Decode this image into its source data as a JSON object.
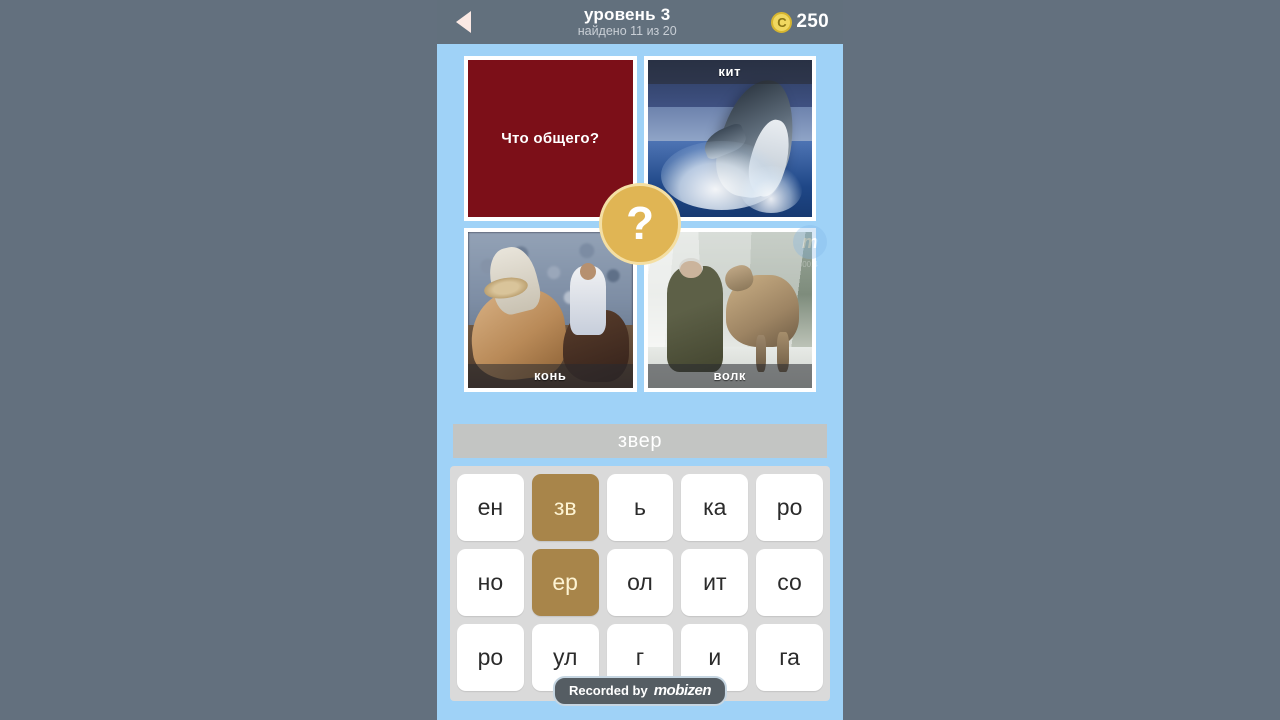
{
  "colors": {
    "letterbox": "#63707e",
    "header_bg": "#62707d",
    "app_bg": "#9fd2f7",
    "question_tile": "#7c0f18",
    "badge_gold": "#e0b554",
    "key_used": "#a8854a",
    "answer_bar": "#c3c5c3",
    "keyboard_bg": "#dadada"
  },
  "header": {
    "back_icon": "back-triangle-icon",
    "title": "уровень 3",
    "subtitle": "найдено 11 из 20",
    "coin_icon": "coin-icon",
    "coin_glyph": "C",
    "coin_count": "250"
  },
  "pictures": [
    {
      "name": "question-tile",
      "caption": "Что общего?",
      "caption_position": "center",
      "kind": "prompt"
    },
    {
      "name": "whale-photo",
      "caption": "кит",
      "caption_position": "top",
      "kind": "photo"
    },
    {
      "name": "horse-photo",
      "caption": "конь",
      "caption_position": "bottom",
      "kind": "photo"
    },
    {
      "name": "wolf-photo",
      "caption": "волк",
      "caption_position": "bottom",
      "kind": "photo"
    }
  ],
  "center_badge": {
    "glyph": "?",
    "icon": "question-mark-badge-icon"
  },
  "rec_widget": {
    "glyph": "m",
    "timer": "00:4"
  },
  "answer": {
    "text": "звер"
  },
  "keyboard": {
    "rows": [
      [
        {
          "label": "ен",
          "used": false
        },
        {
          "label": "зв",
          "used": true
        },
        {
          "label": "ь",
          "used": false
        },
        {
          "label": "ка",
          "used": false
        },
        {
          "label": "ро",
          "used": false
        }
      ],
      [
        {
          "label": "но",
          "used": false
        },
        {
          "label": "ер",
          "used": true
        },
        {
          "label": "ол",
          "used": false
        },
        {
          "label": "ит",
          "used": false
        },
        {
          "label": "со",
          "used": false
        }
      ],
      [
        {
          "label": "ро",
          "used": false
        },
        {
          "label": "ул",
          "used": false
        },
        {
          "label": "г",
          "used": false
        },
        {
          "label": "и",
          "used": false
        },
        {
          "label": "га",
          "used": false
        }
      ]
    ]
  },
  "watermark": {
    "prefix": "Recorded by",
    "brand": "mobizen"
  }
}
